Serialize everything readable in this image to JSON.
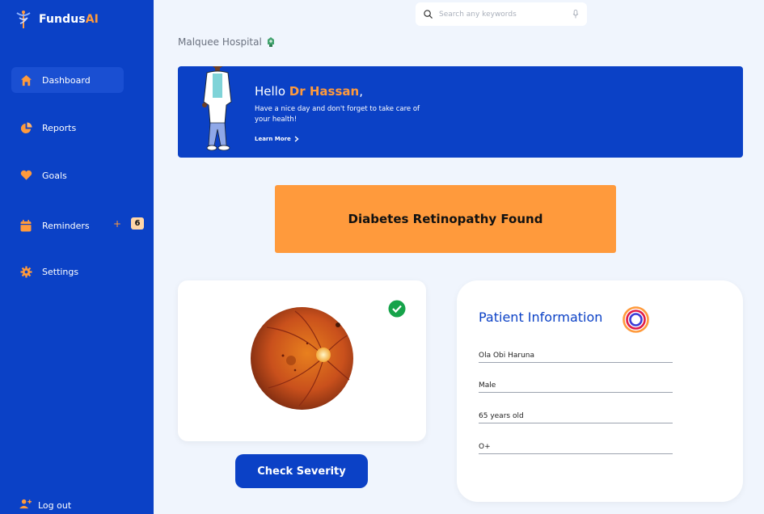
{
  "app": {
    "name_prefix": "Fundus",
    "name_suffix": "AI",
    "accent": "#ff9a3c",
    "brand": "#0b41c6"
  },
  "sidebar": {
    "items": [
      {
        "label": "Dashboard",
        "icon": "home-icon"
      },
      {
        "label": "Reports",
        "icon": "pie-chart-icon"
      },
      {
        "label": "Goals",
        "icon": "heart-icon"
      },
      {
        "label": "Reminders",
        "icon": "calendar-icon"
      },
      {
        "label": "Settings",
        "icon": "gear-icon"
      }
    ],
    "reminder_add": "+",
    "reminder_count": "6",
    "logout_label": "Log out"
  },
  "search": {
    "placeholder": "Search any keywords"
  },
  "hospital": "Malquee Hospital",
  "banner": {
    "hello": "Hello ",
    "doctor_name": "Dr Hassan",
    "comma": ",",
    "subtitle": "Have a nice day and don't forget to take care of your health!",
    "learn_more": "Learn More"
  },
  "result": "Diabetes Retinopathy Found",
  "check_severity": "Check Severity",
  "patient": {
    "title": "Patient Information",
    "name": "Ola Obi Haruna",
    "gender": "Male",
    "age": "65 years old",
    "blood_group": "O+"
  }
}
